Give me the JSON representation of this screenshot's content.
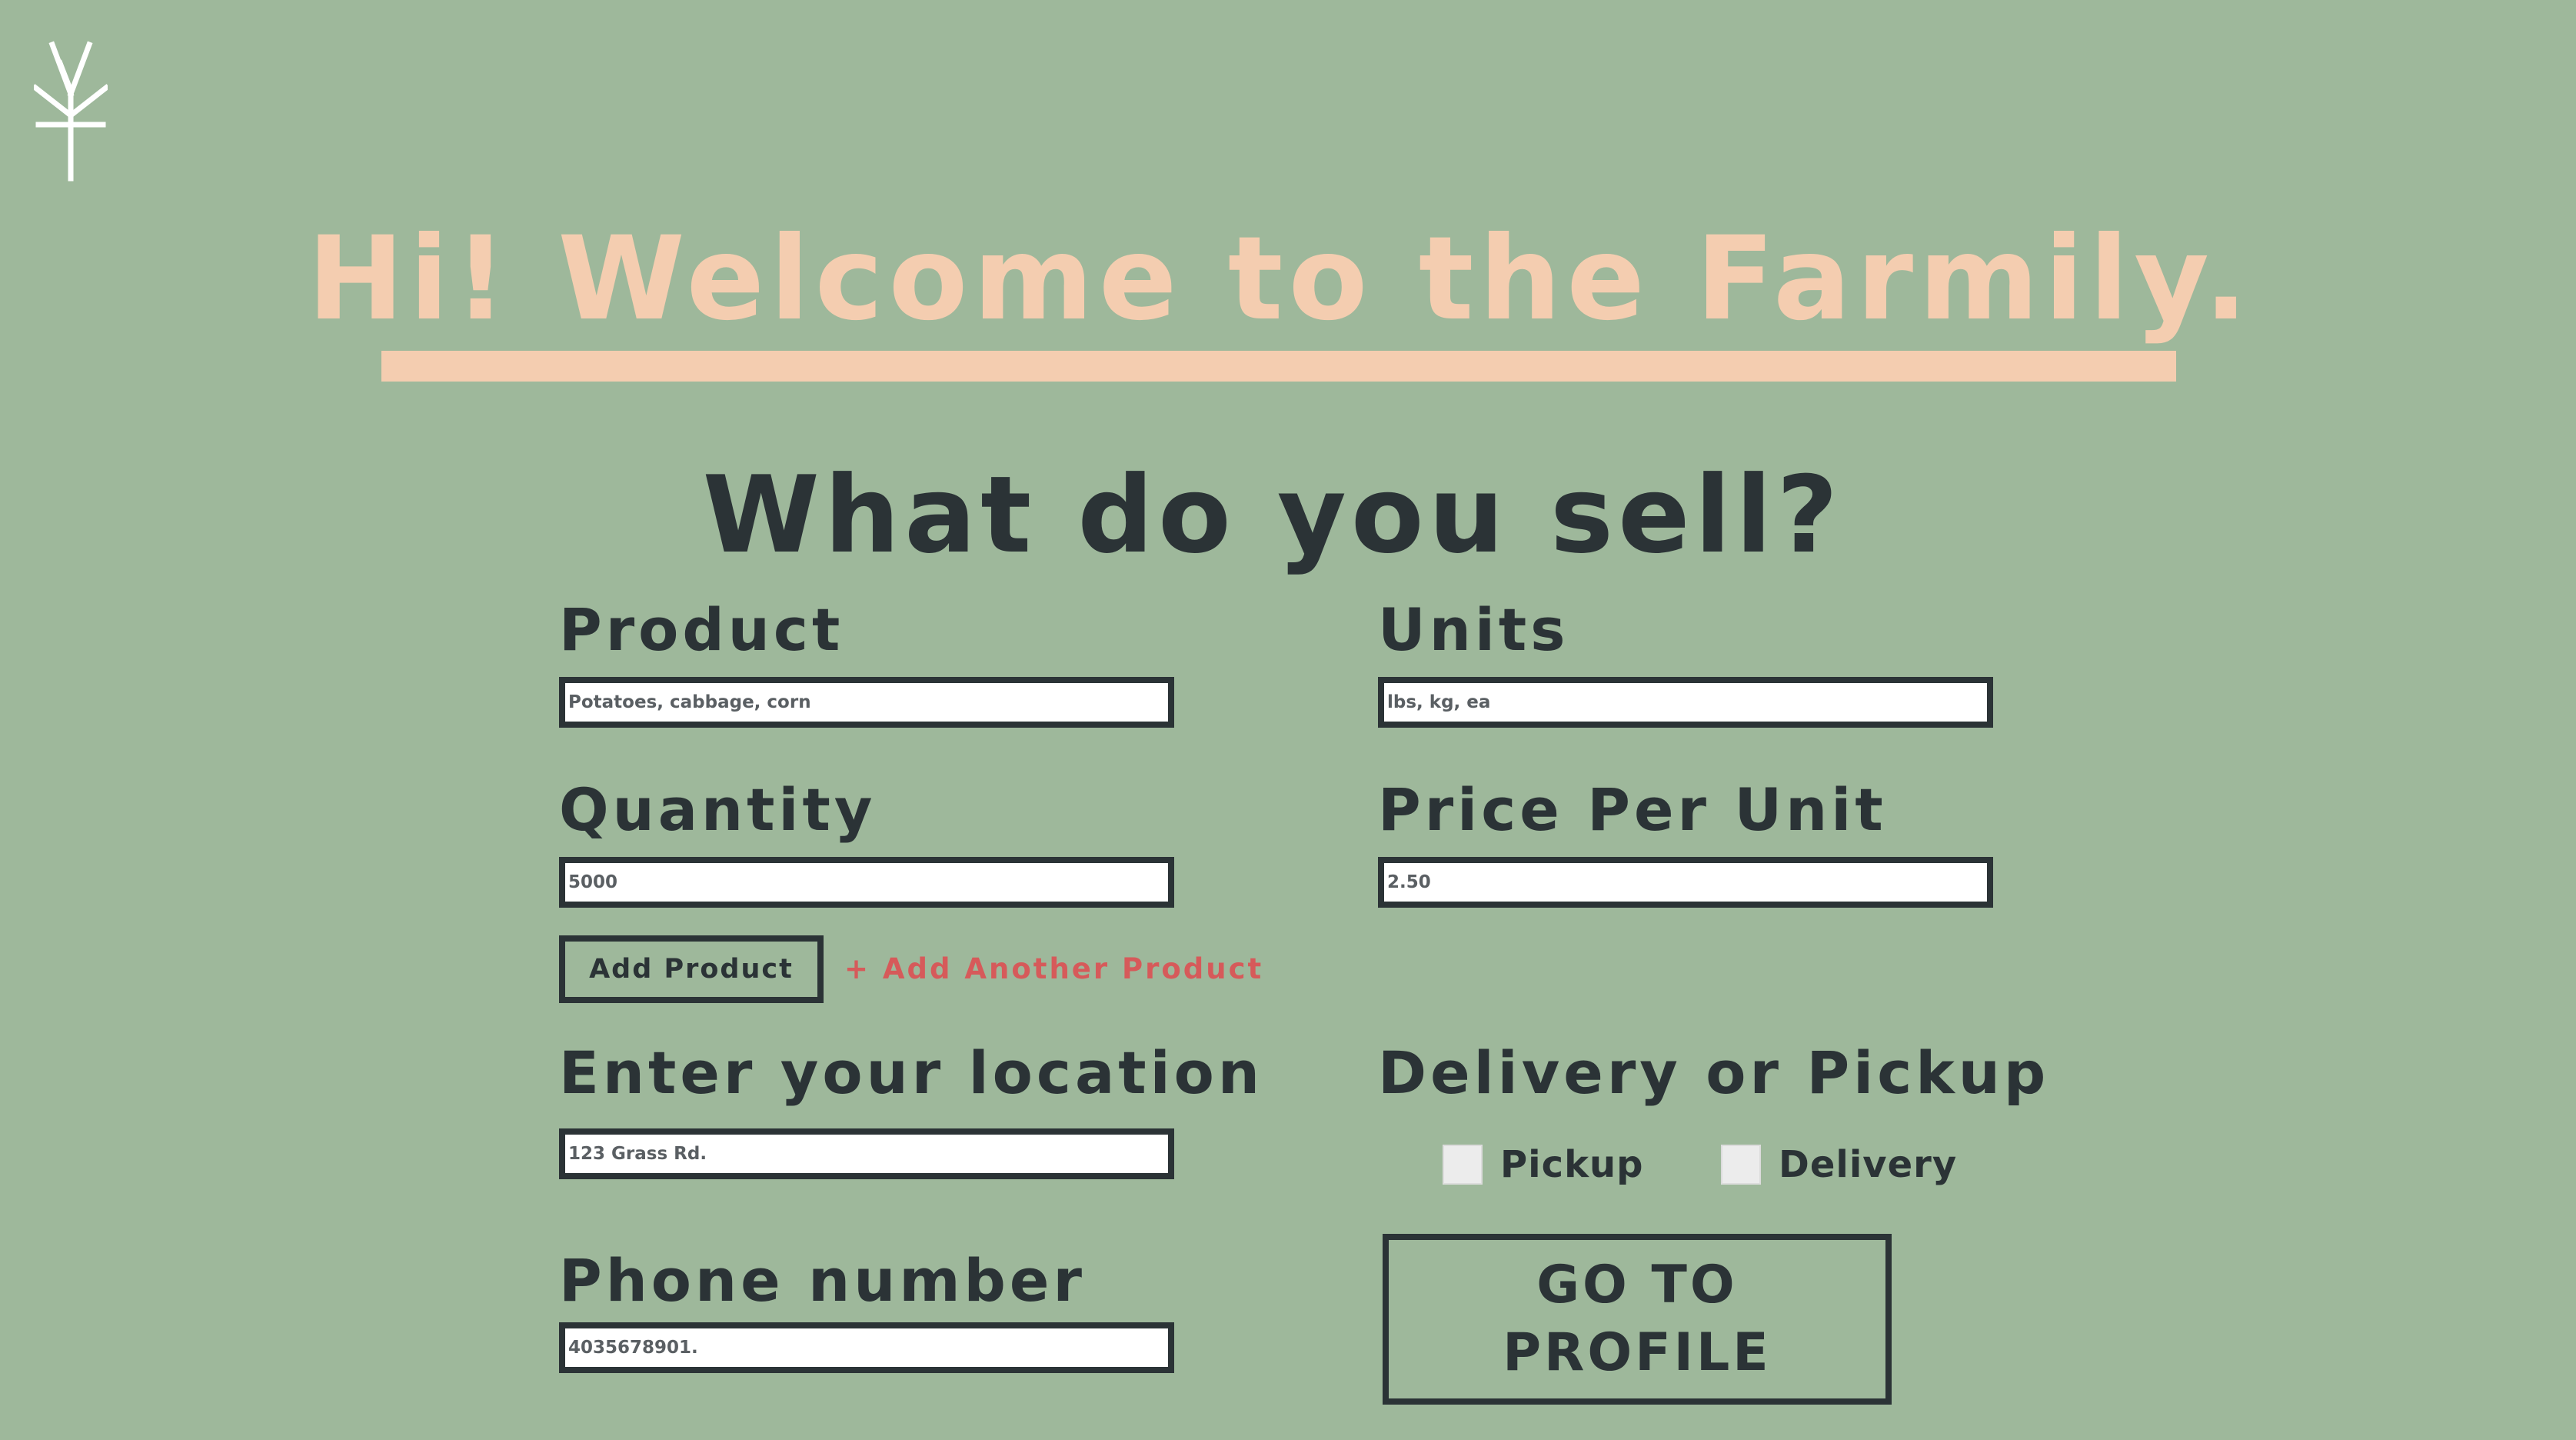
{
  "header": {
    "logo_icon": "farm-sprout-logo-icon",
    "welcome_title": "Hi! Welcome to the Farmily."
  },
  "form": {
    "question": "What do you sell?",
    "product": {
      "label": "Product",
      "placeholder": "Potatoes, cabbage, corn"
    },
    "units": {
      "label": "Units",
      "placeholder": "lbs, kg, ea"
    },
    "quantity": {
      "label": "Quantity",
      "placeholder": "5000"
    },
    "price": {
      "label": "Price Per Unit",
      "placeholder": "2.50"
    },
    "add_product_label": "Add Product",
    "add_another_label": "+ Add Another Product",
    "location": {
      "label": "Enter your location",
      "placeholder": "123 Grass Rd."
    },
    "phone": {
      "label": "Phone number",
      "placeholder": "4035678901."
    },
    "delivery": {
      "label": "Delivery or Pickup",
      "options": [
        "Pickup",
        "Delivery"
      ]
    },
    "profile_button": {
      "line1": "GO TO",
      "line2": "PROFILE"
    }
  },
  "colors": {
    "background": "#9eb89b",
    "accent": "#f4cdb0",
    "text": "#2b3336",
    "link": "#d65a5a"
  }
}
